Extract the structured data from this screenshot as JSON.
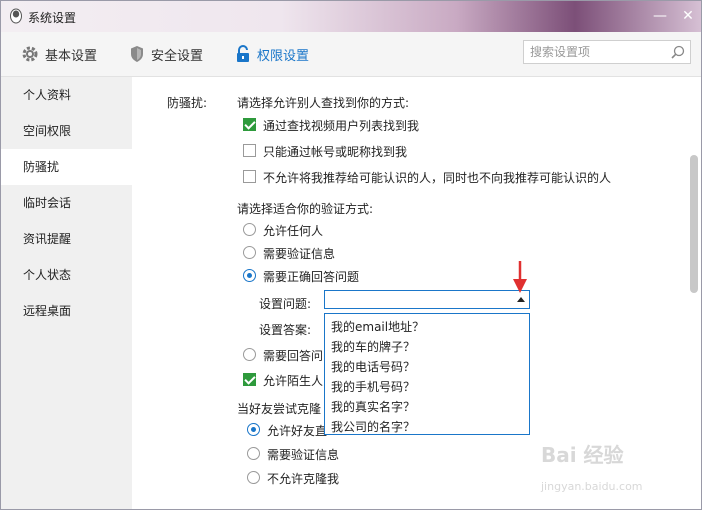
{
  "window": {
    "title": "系统设置",
    "minimize_glyph": "—",
    "close_glyph": "✕"
  },
  "toolbar": {
    "items": [
      {
        "label": "基本设置",
        "icon": "gear-icon"
      },
      {
        "label": "安全设置",
        "icon": "shield-icon"
      },
      {
        "label": "权限设置",
        "icon": "lock-icon",
        "active": true
      }
    ],
    "search_placeholder": "搜索设置项"
  },
  "sidebar": {
    "items": [
      {
        "label": "个人资料"
      },
      {
        "label": "空间权限"
      },
      {
        "label": "防骚扰",
        "active": true
      },
      {
        "label": "临时会话"
      },
      {
        "label": "资讯提醒"
      },
      {
        "label": "个人状态"
      },
      {
        "label": "远程桌面"
      }
    ]
  },
  "main": {
    "section_label": "防骚扰:",
    "find_heading": "请选择允许别人查找到你的方式:",
    "find_options": [
      {
        "label": "通过查找视频用户列表找到我",
        "checked": true
      },
      {
        "label": "只能通过帐号或昵称找到我",
        "checked": false
      },
      {
        "label": "不允许将我推荐给可能认识的人，同时也不向我推荐可能认识的人",
        "checked": false
      }
    ],
    "verify_heading": "请选择适合你的验证方式:",
    "verify_options": [
      {
        "label": "允许任何人",
        "checked": false
      },
      {
        "label": "需要验证信息",
        "checked": false
      },
      {
        "label": "需要正确回答问题",
        "checked": true
      }
    ],
    "question_label": "设置问题:",
    "question_value": "",
    "answer_label": "设置答案:",
    "answer_option_partial": "需要回答问",
    "stranger_partial": "允许陌生人",
    "clone_heading_partial": "当好友尝试克隆",
    "clone_options": [
      {
        "label": "允许好友直",
        "checked": true
      },
      {
        "label": "需要验证信息",
        "checked": false
      },
      {
        "label": "不允许克隆我",
        "checked": false
      }
    ],
    "dropdown_options": [
      "我的email地址？",
      "我的车的牌子？",
      "我的电话号码？",
      "我的手机号码？",
      "我的真实名字？",
      "我公司的名字？"
    ]
  },
  "watermark": {
    "brand": "Bai  经验",
    "url": "jingyan.baidu.com"
  },
  "colors": {
    "accent": "#1a76c9",
    "check_green": "#2e9a3c",
    "annotation_red": "#e03030"
  }
}
